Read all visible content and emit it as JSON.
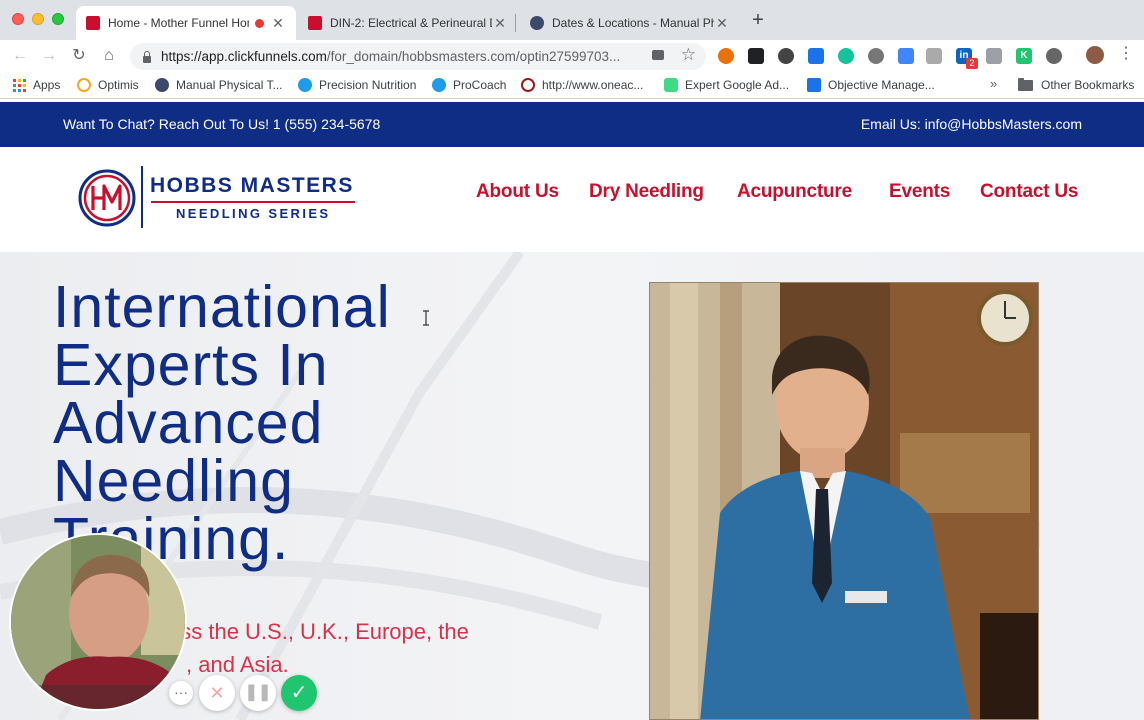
{
  "browser": {
    "tabs": [
      {
        "title": "Home - Mother Funnel Hom",
        "active": true,
        "recording": true
      },
      {
        "title": "DIN-2: Electrical & Perineural D",
        "active": false
      },
      {
        "title": "Dates & Locations - Manual Ph",
        "active": false
      }
    ],
    "url_host": "https://app.clickfunnels.com",
    "url_path": "/for_domain/hobbsmasters.com/optin27599703...",
    "bookmarks": [
      {
        "label": "Apps",
        "icon": "apps-grid-icon"
      },
      {
        "label": "Optimis",
        "icon": "optimis-icon"
      },
      {
        "label": "Manual Physical T...",
        "icon": "globe-icon"
      },
      {
        "label": "Precision Nutrition",
        "icon": "pn-icon"
      },
      {
        "label": "ProCoach",
        "icon": "pn-icon"
      },
      {
        "label": "http://www.oneac...",
        "icon": "oneaccord-icon"
      },
      {
        "label": "Expert Google Ad...",
        "icon": "android-icon"
      },
      {
        "label": "Objective Manage...",
        "icon": "doc-icon"
      }
    ],
    "other_bookmarks": "Other Bookmarks",
    "more_bookmarks": "»",
    "extension_badge": "2"
  },
  "topbar": {
    "chat": "Want To Chat? Reach Out To Us! 1 (555) 234-5678",
    "email": "Email Us: info@HobbsMasters.com"
  },
  "logo": {
    "monogram": "HM",
    "name": "HOBBS MASTERS",
    "tagline": "NEEDLING SERIES"
  },
  "nav": [
    "About Us",
    "Dry Needling",
    "Acupuncture",
    "Events",
    "Contact Us"
  ],
  "hero": {
    "title_lines": [
      "International",
      "Experts In",
      "Advanced",
      "Needling",
      "Training."
    ],
    "subtitle_line1": "oss the U.S., U.K., Europe, the",
    "subtitle_line2": ", and Asia."
  },
  "recorder": {
    "more": "···",
    "cancel": "✕",
    "pause": "❚❚",
    "done": "✓"
  },
  "colors": {
    "brand_navy": "#0f2d84",
    "brand_red": "#c8102e",
    "subtitle_red": "#d6324b",
    "record_green": "#1fc56f"
  }
}
